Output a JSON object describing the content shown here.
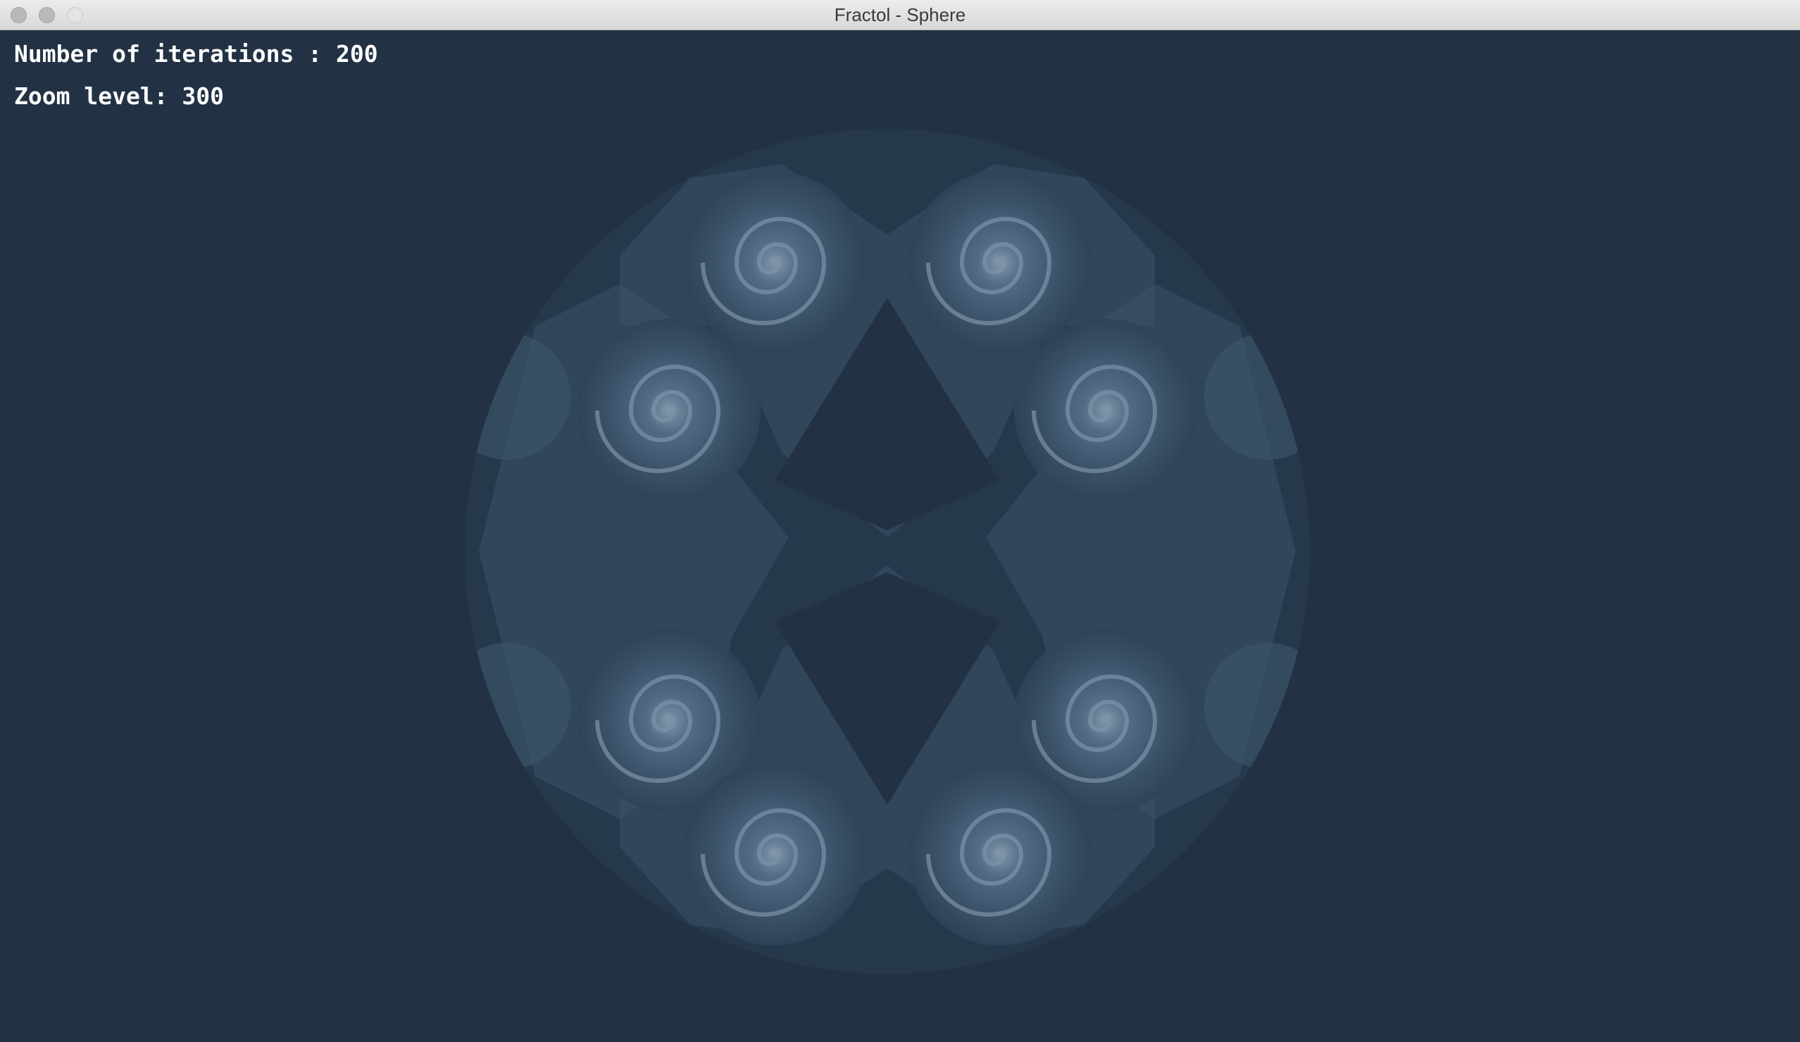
{
  "window": {
    "title": "Fractol - Sphere",
    "controls": [
      "close",
      "minimize",
      "zoom"
    ]
  },
  "hud": {
    "iterations_text": "Number of iterations : 200",
    "zoom_text": "Zoom level: 300"
  },
  "canvas": {
    "image": "fractal-sphere-render",
    "background_color": "#223244",
    "fractal_tint": "#4a6177"
  }
}
